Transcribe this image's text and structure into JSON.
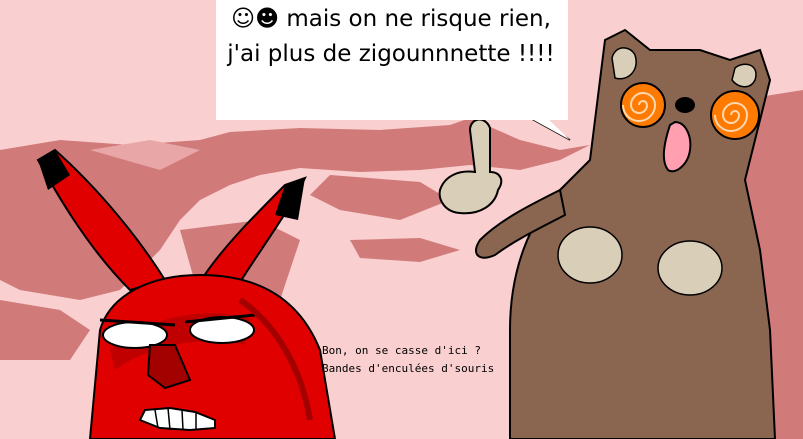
{
  "speech_bubble": {
    "line1": "☺☻ mais on ne risque rien,",
    "line2": "j'ai plus de zigounnnette !!!!"
  },
  "caption": {
    "line1": "Bon, on se casse d'ici ?",
    "line2": "Bandes d'enculées d'souris"
  },
  "colors": {
    "sky": "#f9cfcf",
    "ground": "#d17a7a",
    "red_creature": "#e00000",
    "red_shadow": "#a30000",
    "brown_creature": "#8a6650",
    "belly_spots": "#d9cfb8",
    "eye_orange": "#ff7a00"
  }
}
